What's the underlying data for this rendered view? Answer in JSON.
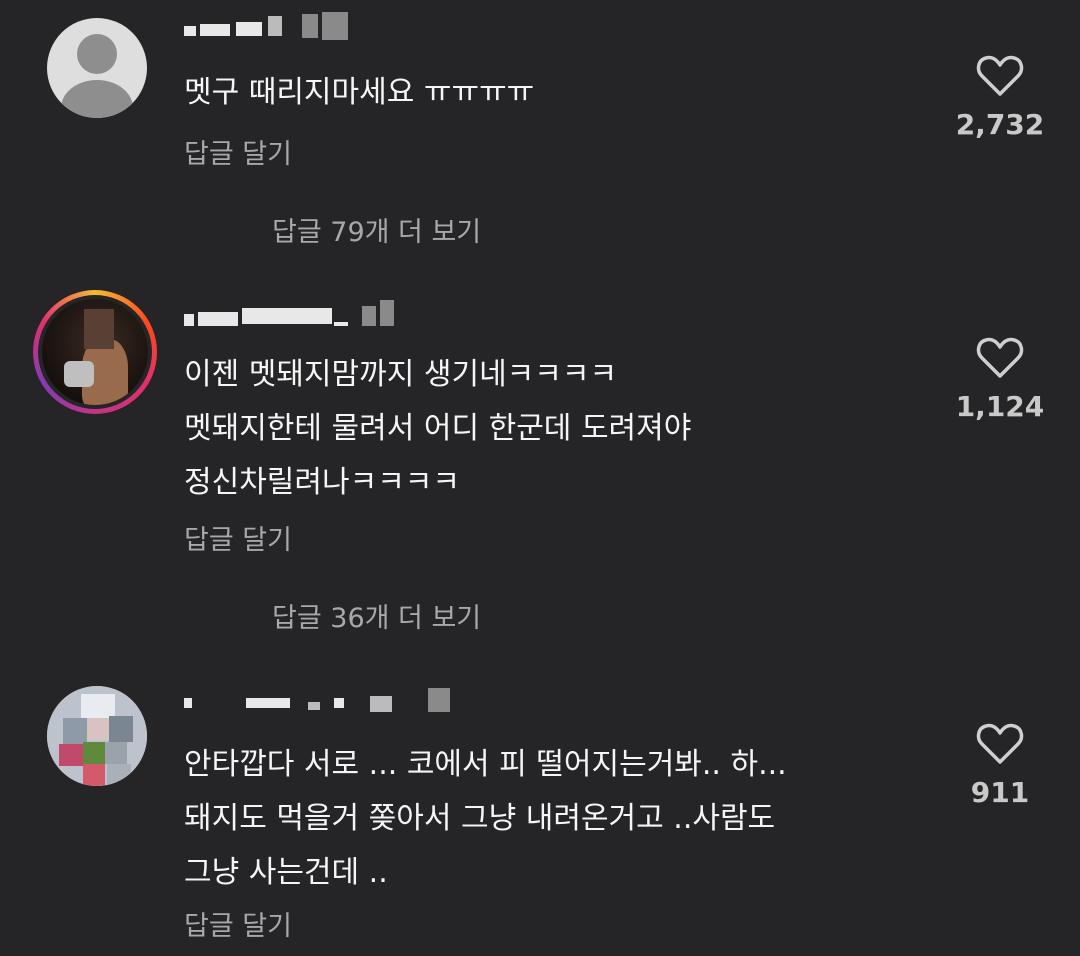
{
  "comments": [
    {
      "text": "멧구 때리지마세요 ㅠㅠㅠㅠ",
      "reply_label": "답글 달기",
      "likes": "2,732",
      "view_replies": "답글 79개 더 보기",
      "avatar": "default-profile-icon"
    },
    {
      "text": "이젠 멧돼지맘까지 생기네ㅋㅋㅋㅋ\n멧돼지한테 물려서 어디 한군데 도려져야\n정신차릴려나ㅋㅋㅋㅋ",
      "reply_label": "답글 달기",
      "likes": "1,124",
      "view_replies": "답글 36개 더 보기",
      "avatar": "story-ring-avatar"
    },
    {
      "text": "안타깝다 서로 ... 코에서 피 떨어지는거봐.. 하...\n돼지도 먹을거 쫒아서 그냥 내려온거고 ..사람도\n그냥 사는건데 ..",
      "reply_label": "답글 달기",
      "likes": "911",
      "avatar": "pixelated-avatar"
    }
  ],
  "icons": {
    "like": "heart-outline-icon"
  },
  "colors": {
    "background": "#252427",
    "text": "#f5f5f5",
    "secondary_text": "#a8a8a8"
  }
}
